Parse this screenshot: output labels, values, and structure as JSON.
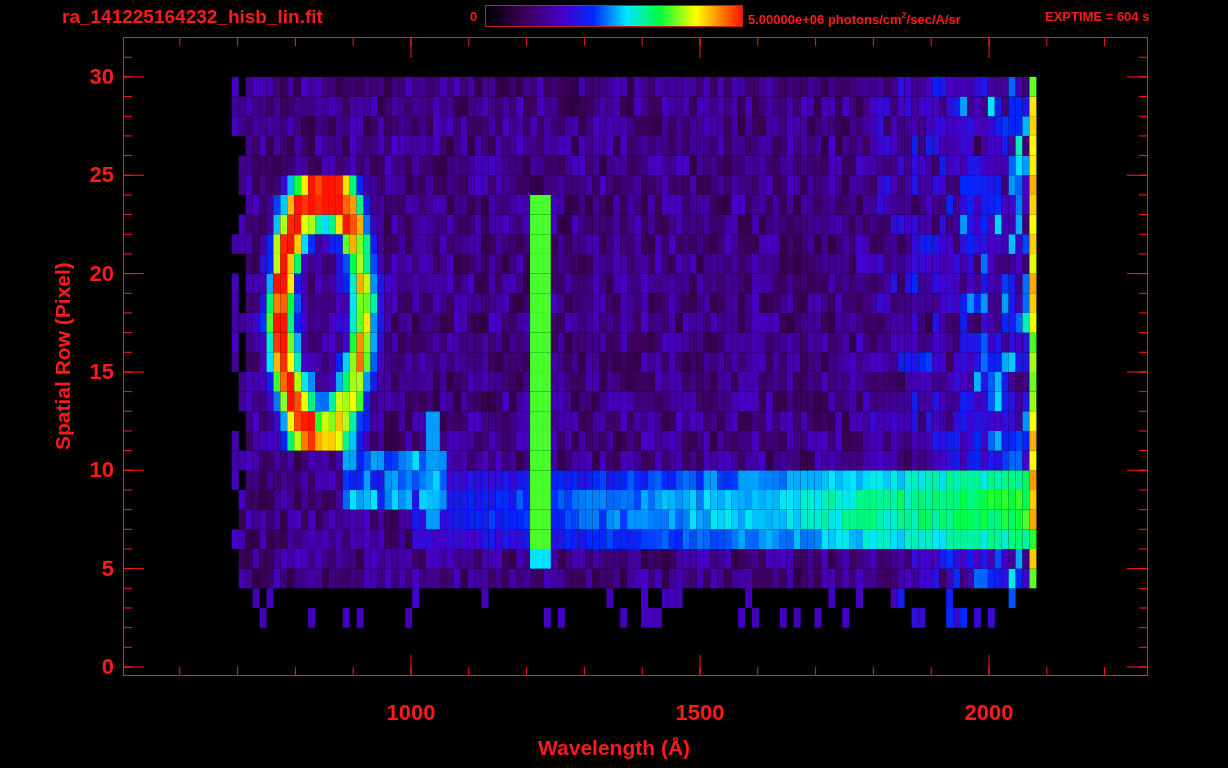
{
  "title": "ra_141225164232_hisb_lin.fit",
  "colorbar": {
    "min_label": "0",
    "max_label": "5.00000e+06 photons/cm$^{2}$/sec/A/sr"
  },
  "exposure": "EXPTIME = 604 s",
  "y_axis": {
    "label": "Spatial Row (Pixel)",
    "ticks": [
      "30",
      "25",
      "20",
      "15",
      "10",
      "5",
      "0"
    ]
  },
  "x_axis": {
    "label": "Wavelength (Å)",
    "ticks": [
      "1000",
      "1500",
      "2000"
    ]
  }
}
